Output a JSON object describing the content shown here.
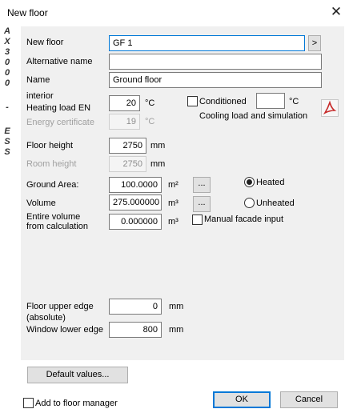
{
  "window": {
    "title": "New floor",
    "close_glyph": "✕"
  },
  "side_label": {
    "chars": [
      "A",
      "X",
      "3",
      "0",
      "0",
      "0",
      "-",
      "E",
      "S",
      "S"
    ]
  },
  "fields": {
    "new_floor": {
      "label": "New floor",
      "value": "GF 1",
      "button": ">"
    },
    "alternative_name": {
      "label": "Alternative name",
      "value": ""
    },
    "name": {
      "label": "Name",
      "value": "Ground floor"
    },
    "heating_load": {
      "label_line1": "interior",
      "label_line2": "Heating load EN",
      "value": "20",
      "unit": "°C"
    },
    "conditioned": {
      "label": "Conditioned",
      "checked": false,
      "value": "",
      "unit": "°C",
      "sub_label": "Cooling load and simulation"
    },
    "energy_certificate": {
      "label": "Energy certificate",
      "value": "19",
      "unit": "°C"
    },
    "floor_height": {
      "label": "Floor height",
      "value": "2750",
      "unit": "mm"
    },
    "room_height": {
      "label": "Room height",
      "value": "2750",
      "unit": "mm"
    },
    "ground_area": {
      "label": "Ground Area:",
      "value": "100.0000",
      "unit": "m²",
      "button": "..."
    },
    "volume": {
      "label": "Volume",
      "value": "275.000000",
      "unit": "m³",
      "button": "..."
    },
    "entire_volume": {
      "label_line1": "Entire volume",
      "label_line2": "from calculation",
      "value": "0.000000",
      "unit": "m³"
    },
    "heated": {
      "options": [
        "Heated",
        "Unheated"
      ],
      "selected": "Heated"
    },
    "manual_facade": {
      "label": "Manual facade input",
      "checked": false
    },
    "floor_upper_edge": {
      "label_line1": "Floor upper edge",
      "label_line2": "(absolute)",
      "value": "0",
      "unit": "mm"
    },
    "window_lower_edge": {
      "label": "Window lower edge",
      "value": "800",
      "unit": "mm"
    }
  },
  "buttons": {
    "default_values": "Default values...",
    "ok": "OK",
    "cancel": "Cancel"
  },
  "add_to_floor_manager": {
    "label": "Add to floor manager",
    "checked": false
  },
  "icons": {
    "pdf": "pdf-icon",
    "close": "close-icon",
    "pdf_color": "#c62828"
  }
}
